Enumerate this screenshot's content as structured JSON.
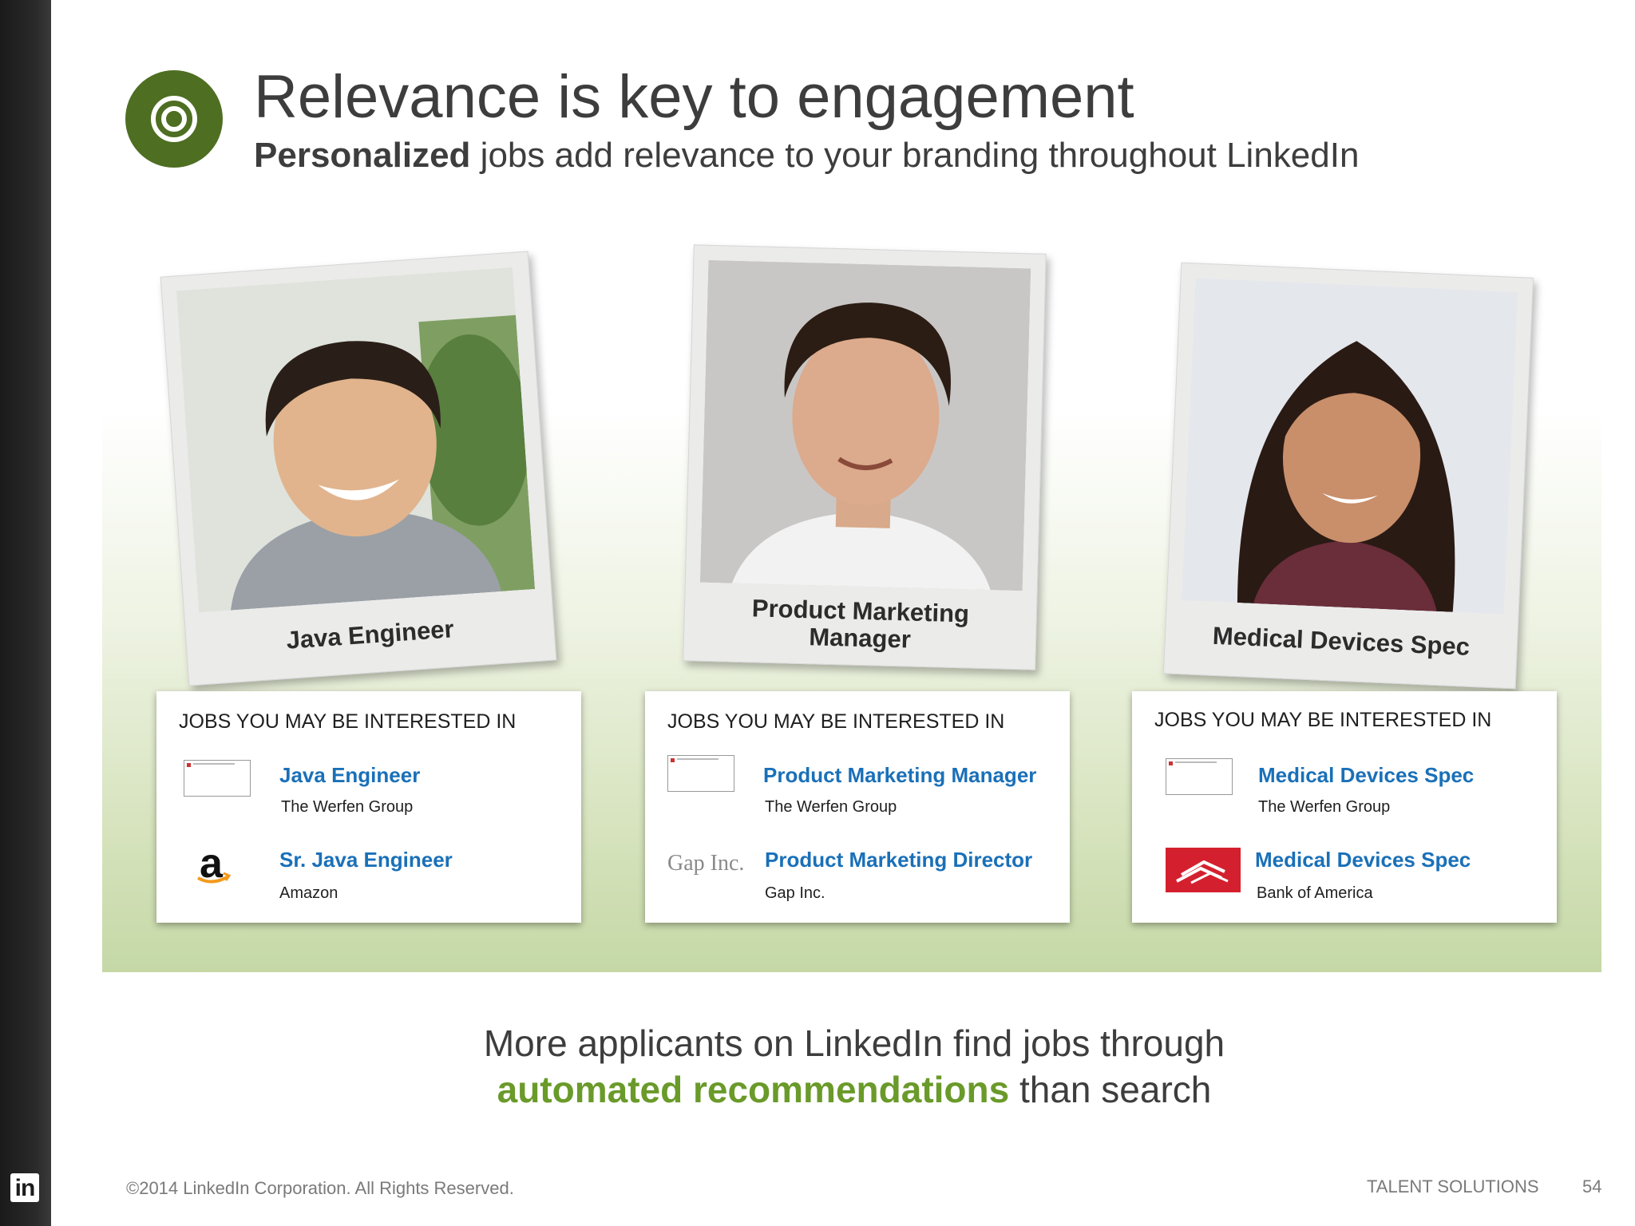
{
  "header": {
    "title": "Relevance is key to engagement",
    "subtitle_bold": "Personalized",
    "subtitle_rest": " jobs add relevance to your branding throughout LinkedIn",
    "icon": "target-icon",
    "icon_color": "#4e6e22"
  },
  "profiles": [
    {
      "caption": "Java Engineer"
    },
    {
      "caption_line1": "Product Marketing",
      "caption_line2": "Manager"
    },
    {
      "caption": "Medical Devices Spec"
    }
  ],
  "cards": [
    {
      "heading": "JOBS YOU MAY BE INTERESTED IN",
      "jobs": [
        {
          "title": "Java Engineer",
          "company": "The Werfen Group",
          "logo": "broken-image-icon"
        },
        {
          "title": "Sr. Java Engineer",
          "company": "Amazon",
          "logo": "amazon-logo",
          "logo_text": "a"
        }
      ]
    },
    {
      "heading": "JOBS YOU MAY BE INTERESTED IN",
      "jobs": [
        {
          "title": "Product Marketing Manager",
          "company": "The Werfen Group",
          "logo": "broken-image-icon"
        },
        {
          "title": "Product Marketing Director",
          "company": "Gap Inc.",
          "logo": "gap-logo",
          "logo_text": "Gap Inc."
        }
      ]
    },
    {
      "heading": "JOBS YOU MAY BE INTERESTED IN",
      "jobs": [
        {
          "title": "Medical Devices Spec",
          "company": "The Werfen Group",
          "logo": "broken-image-icon"
        },
        {
          "title": "Medical Devices Spec",
          "company": "Bank of America",
          "logo": "bank-of-america-logo"
        }
      ]
    }
  ],
  "tagline": {
    "line1": "More applicants on LinkedIn find jobs through",
    "line2_green": "automated recommendations",
    "line2_rest": " than search",
    "green_color": "#6a9a2a"
  },
  "footer": {
    "logo_text": "in",
    "copyright": "©2014 LinkedIn Corporation. All Rights Reserved.",
    "brand": "TALENT SOLUTIONS",
    "page_number": "54"
  },
  "colors": {
    "job_link": "#1a70b8",
    "text": "#3d3d3d"
  }
}
